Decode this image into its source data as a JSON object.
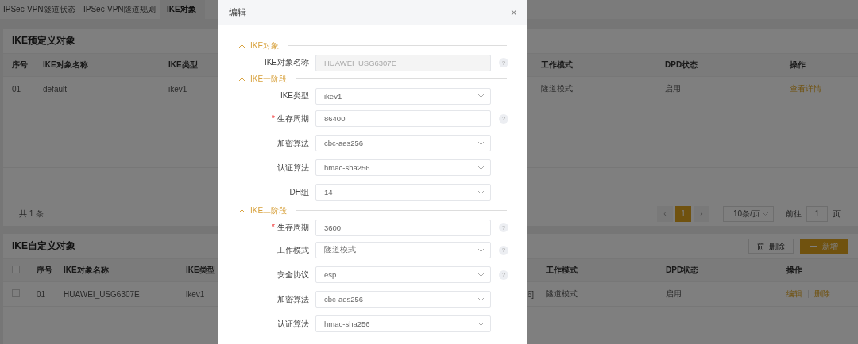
{
  "tabs": [
    {
      "label": "IPSec-VPN隧道状态",
      "selected": false
    },
    {
      "label": "IPSec-VPN隧道规则",
      "selected": false
    },
    {
      "label": "IKE对象",
      "selected": true
    }
  ],
  "predefined": {
    "title": "IKE预定义对象",
    "columns": [
      "序号",
      "IKE对象名称",
      "IKE类型",
      "工作模式",
      "DPD状态",
      "操作"
    ],
    "rows": [
      {
        "cells": [
          "01",
          "default",
          "ikev1",
          "隧道模式",
          "启用"
        ],
        "actions": [
          "查看详情"
        ]
      }
    ],
    "total": "共 1 条",
    "pagination": {
      "prev": "‹",
      "pages": [
        {
          "label": "1",
          "selected": true
        }
      ],
      "next": "›",
      "page_size": "10条/页",
      "goto_label": "前往",
      "goto_value": "1",
      "goto_suffix": "页"
    }
  },
  "custom": {
    "title": "IKE自定义对象",
    "buttons": [
      {
        "kind": "delete",
        "label": "删除"
      },
      {
        "kind": "add",
        "label": "新增"
      }
    ],
    "columns": [
      "序号",
      "IKE对象名称",
      "IKE类型",
      "",
      "工作模式",
      "DPD状态",
      "操作"
    ],
    "rows": [
      {
        "checked": false,
        "cells": [
          "01",
          "HUAWEI_USG6307E",
          "ikev1",
          "6]",
          "隧道模式",
          "启用"
        ],
        "actions": [
          "编辑",
          "删除"
        ]
      }
    ],
    "header_checked": false
  },
  "dialog": {
    "title": "编辑",
    "close": "×",
    "sections": [
      {
        "title": "IKE对象",
        "expanded": true,
        "fields": [
          {
            "kind": "input",
            "label": "IKE对象名称",
            "value": "HUAWEI_USG6307E",
            "disabled": true,
            "help": "?"
          }
        ]
      },
      {
        "title": "IKE一阶段",
        "expanded": true,
        "fields": [
          {
            "kind": "select",
            "label": "IKE类型",
            "value": "ikev1",
            "disabled": false
          },
          {
            "kind": "input",
            "label": "生存周期",
            "value": "86400",
            "disabled": false,
            "required_mark": "*",
            "help": "?"
          },
          {
            "kind": "select",
            "label": "加密算法",
            "value": "cbc-aes256",
            "disabled": false
          },
          {
            "kind": "select",
            "label": "认证算法",
            "value": "hmac-sha256",
            "disabled": false
          },
          {
            "kind": "select",
            "label": "DH组",
            "value": "14",
            "disabled": false
          }
        ]
      },
      {
        "title": "IKE二阶段",
        "expanded": true,
        "fields": [
          {
            "kind": "input",
            "label": "生存周期",
            "value": "3600",
            "disabled": false,
            "required_mark": "*",
            "help": "?"
          },
          {
            "kind": "select",
            "label": "工作模式",
            "value": "隧道模式",
            "disabled": false,
            "help": "?"
          },
          {
            "kind": "select",
            "label": "安全协议",
            "value": "esp",
            "disabled": false,
            "help": "?"
          },
          {
            "kind": "select",
            "label": "加密算法",
            "value": "cbc-aes256",
            "disabled": false
          },
          {
            "kind": "select",
            "label": "认证算法",
            "value": "hmac-sha256",
            "disabled": false
          }
        ]
      }
    ]
  }
}
